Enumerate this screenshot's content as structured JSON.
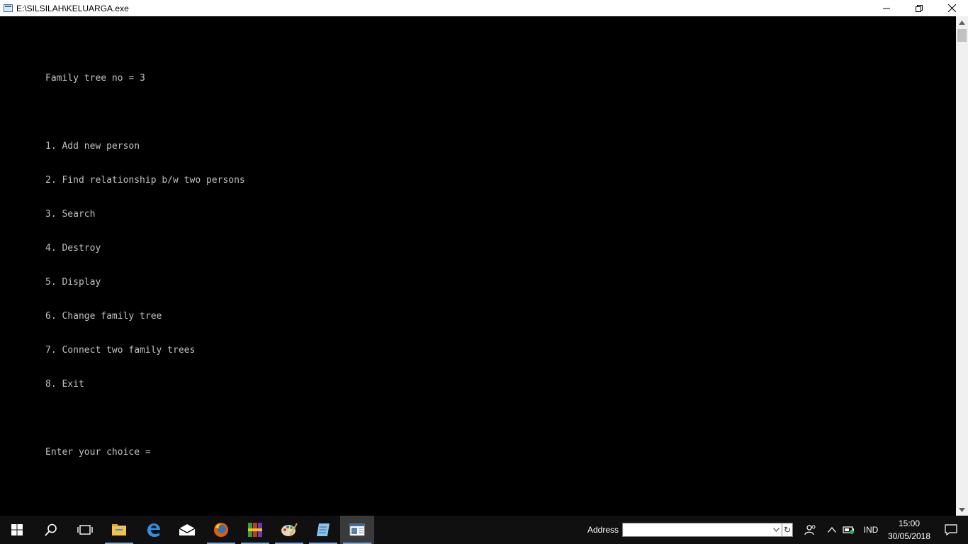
{
  "window": {
    "title": "E:\\SILSILAH\\KELUARGA.exe"
  },
  "console": {
    "header": "Family tree no = 3",
    "menu": [
      "1. Add new person",
      "2. Find relationship b/w two persons",
      "3. Search",
      "4. Destroy",
      "5. Display",
      "6. Change family tree",
      "7. Connect two family trees",
      "8. Exit"
    ],
    "prompt": "Enter your choice = ",
    "text_color": "#c0c0c0",
    "background": "#000000"
  },
  "taskbar": {
    "apps": [
      {
        "name": "start",
        "icon": "windows-logo-icon"
      },
      {
        "name": "search",
        "icon": "search-icon"
      },
      {
        "name": "task-view",
        "icon": "task-view-icon"
      },
      {
        "name": "file-explorer",
        "icon": "folder-icon"
      },
      {
        "name": "edge",
        "icon": "edge-icon"
      },
      {
        "name": "mail",
        "icon": "mail-icon"
      },
      {
        "name": "firefox",
        "icon": "firefox-icon"
      },
      {
        "name": "winrar",
        "icon": "winrar-icon"
      },
      {
        "name": "paint",
        "icon": "paint-palette-icon"
      },
      {
        "name": "notepad",
        "icon": "notepad-icon"
      },
      {
        "name": "console",
        "icon": "console-window-icon"
      }
    ],
    "address_label": "Address",
    "address_value": "",
    "language": "IND",
    "time": "15:00",
    "date": "30/05/2018"
  }
}
